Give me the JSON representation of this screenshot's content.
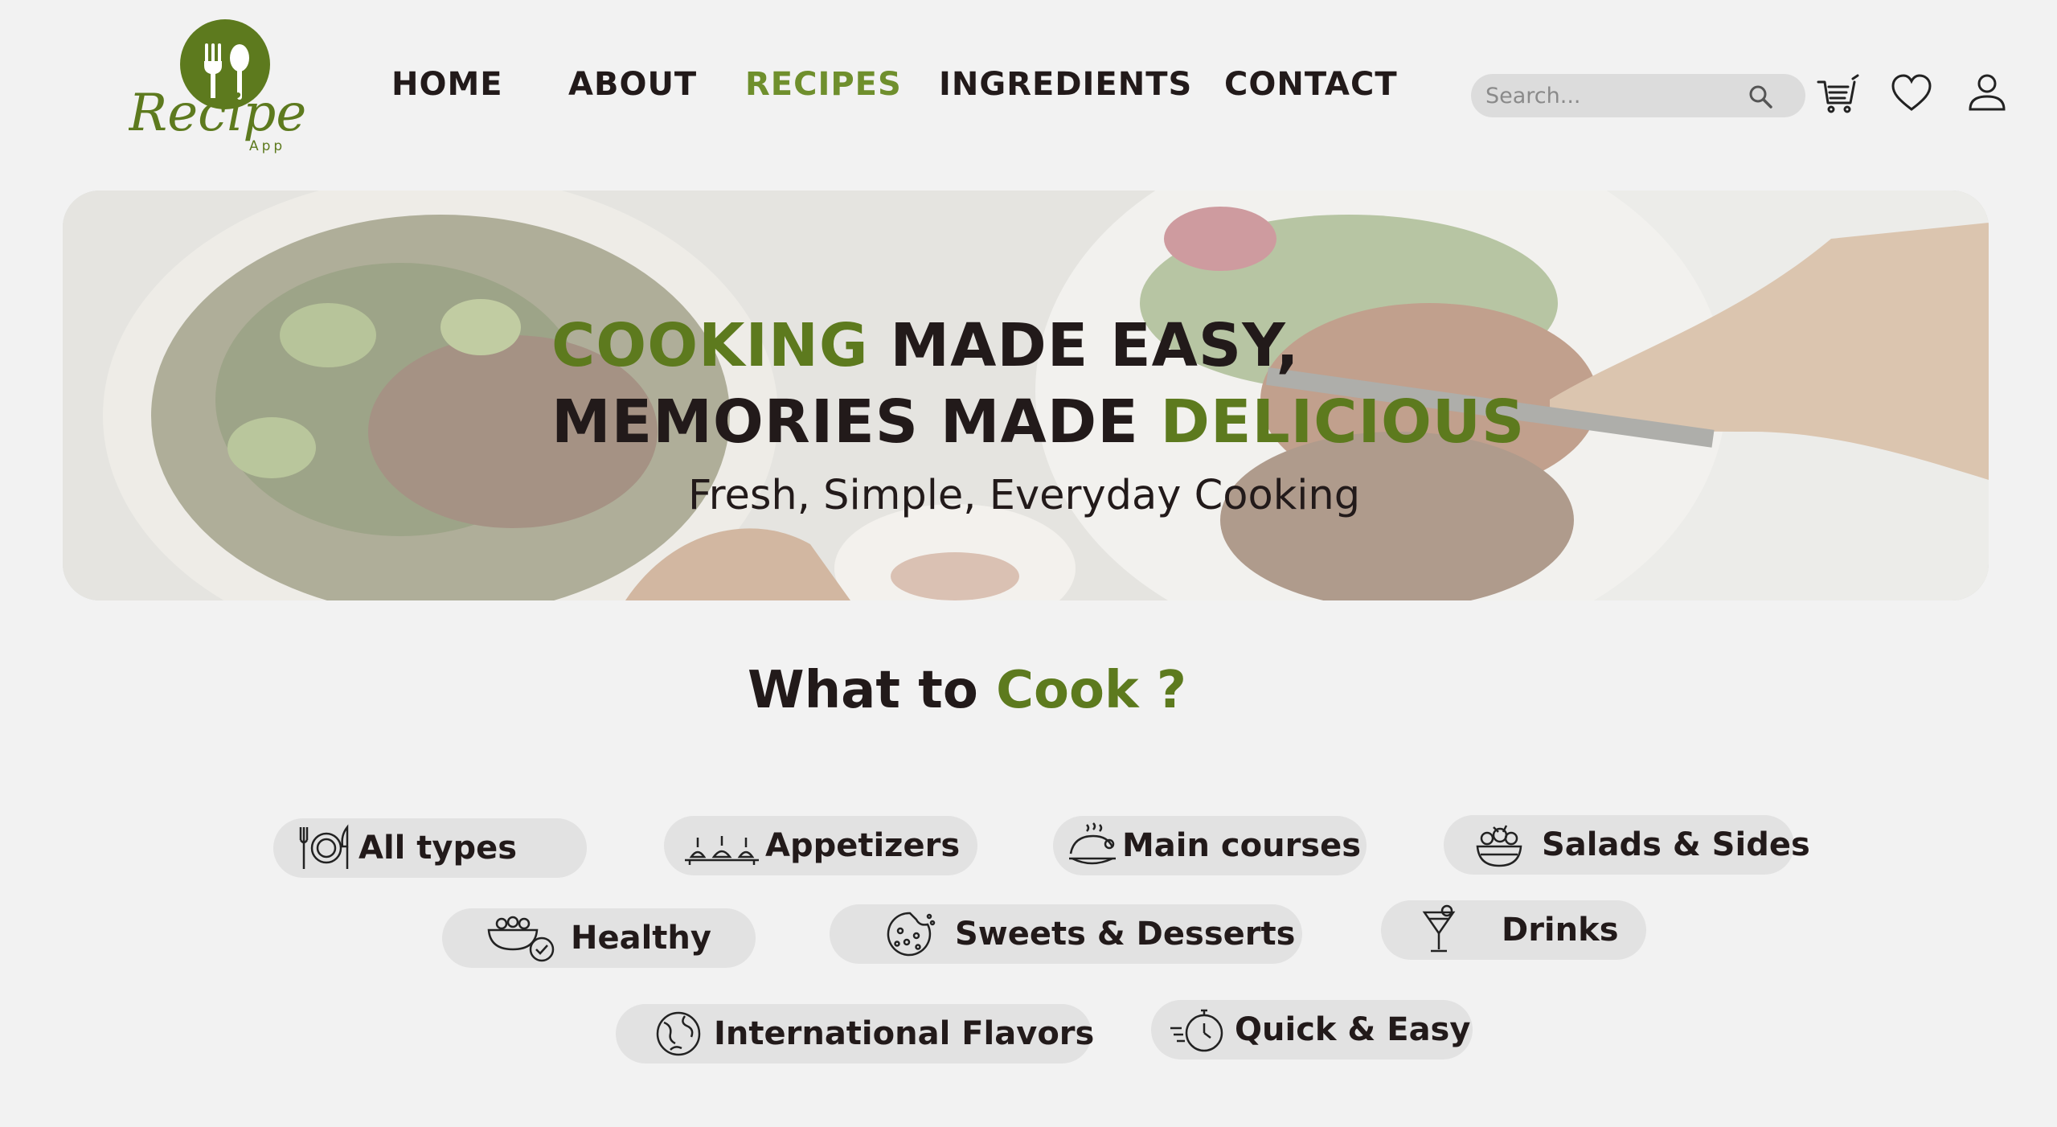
{
  "brand": {
    "logo_text": "Recipe",
    "logo_sub": "App",
    "accent": "#5d7a1e"
  },
  "nav": {
    "items": [
      {
        "label": "HOME",
        "active": false
      },
      {
        "label": "ABOUT",
        "active": false
      },
      {
        "label": "RECIPES",
        "active": true
      },
      {
        "label": "INGREDIENTS",
        "active": false
      },
      {
        "label": "CONTACT",
        "active": false
      }
    ]
  },
  "search": {
    "placeholder": "Search...",
    "value": "",
    "icon": "search-icon"
  },
  "header_icons": {
    "cart": "cart-icon",
    "favorites": "heart-icon",
    "account": "user-icon"
  },
  "hero": {
    "line1_highlight": "COOKING",
    "line1_rest": " MADE EASY,",
    "line2_rest": "MEMORIES MADE ",
    "line2_highlight": "DELICIOUS",
    "subtitle": "Fresh, Simple, Everyday Cooking"
  },
  "section": {
    "title_plain": "What to ",
    "title_highlight": "Cook ?"
  },
  "categories": [
    {
      "label": "All types",
      "icon": "plate-cutlery-icon"
    },
    {
      "label": "Appetizers",
      "icon": "appetizers-icon"
    },
    {
      "label": "Main courses",
      "icon": "roast-chicken-icon"
    },
    {
      "label": "Salads & Sides",
      "icon": "salad-bowl-icon"
    },
    {
      "label": "Healthy",
      "icon": "healthy-bowl-icon"
    },
    {
      "label": "Sweets & Desserts",
      "icon": "cookie-icon"
    },
    {
      "label": "Drinks",
      "icon": "cocktail-icon"
    },
    {
      "label": "International Flavors",
      "icon": "globe-icon"
    },
    {
      "label": "Quick & Easy",
      "icon": "stopwatch-icon"
    }
  ]
}
